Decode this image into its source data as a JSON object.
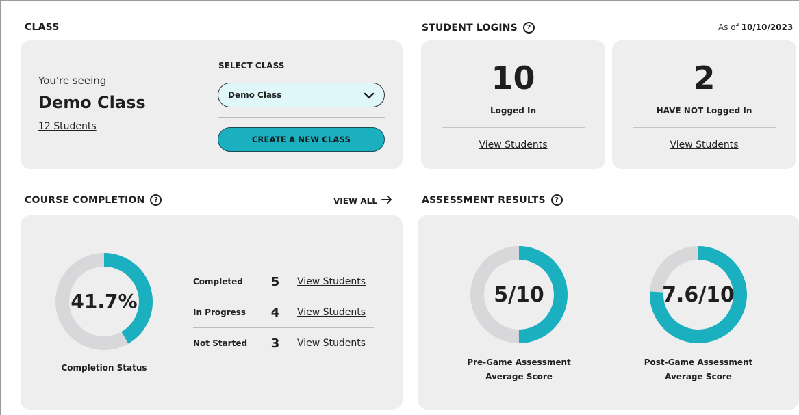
{
  "class_section": {
    "title": "CLASS",
    "seeing_label": "You're seeing",
    "class_name": "Demo Class",
    "students_link": "12 Students",
    "select_label": "SELECT CLASS",
    "selected_class": "Demo Class",
    "create_button": "CREATE A NEW CLASS"
  },
  "logins": {
    "title": "STUDENT LOGINS",
    "as_of_prefix": "As of",
    "as_of_date": "10/10/2023",
    "logged_in": {
      "count": "10",
      "label": "Logged In",
      "link": "View Students"
    },
    "not_logged_in": {
      "count": "2",
      "label": "HAVE NOT Logged In",
      "link": "View Students"
    }
  },
  "completion": {
    "title": "COURSE COMPLETION",
    "view_all": "VIEW ALL",
    "percent_text": "41.7%",
    "percent_value": 41.7,
    "caption": "Completion Status",
    "rows": [
      {
        "label": "Completed",
        "count": "5",
        "link": "View Students"
      },
      {
        "label": "In Progress",
        "count": "4",
        "link": "View Students"
      },
      {
        "label": "Not Started",
        "count": "3",
        "link": "View Students"
      }
    ]
  },
  "assessment": {
    "title": "ASSESSMENT RESULTS",
    "pre": {
      "score_text": "5/10",
      "score": 5,
      "max": 10,
      "caption_line1": "Pre-Game Assessment",
      "caption_line2": "Average Score"
    },
    "post": {
      "score_text": "7.6/10",
      "score": 7.6,
      "max": 10,
      "caption_line1": "Post-Game Assessment",
      "caption_line2": "Average Score"
    }
  },
  "icons": {
    "help": "question-circle-icon",
    "chevron": "chevron-down-icon",
    "arrow": "arrow-right-icon"
  },
  "colors": {
    "accent": "#1ab0bf",
    "track": "#d8d8da",
    "card": "#eeeeef",
    "select_bg": "#e0f7f9"
  }
}
